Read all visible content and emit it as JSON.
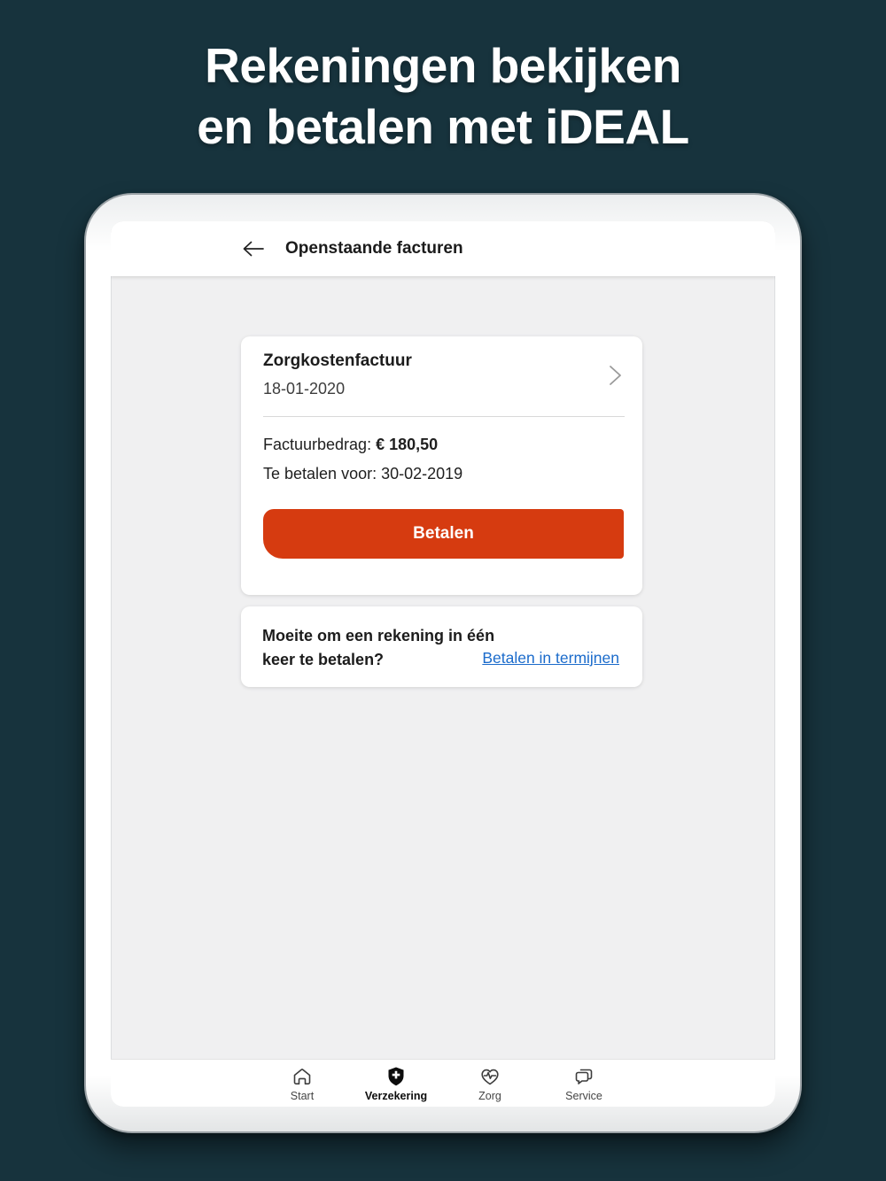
{
  "hero": {
    "title_line1": "Rekeningen bekijken",
    "title_line2": "en betalen met iDEAL"
  },
  "app": {
    "header": {
      "title": "Openstaande facturen",
      "back_icon": "arrow-left"
    },
    "invoice_card": {
      "title": "Zorgkostenfactuur",
      "date": "18-01-2020",
      "chevron_icon": "chevron-right",
      "amount_label": "Factuurbedrag: ",
      "amount_value": "€ 180,50",
      "due_label": "Te betalen voor: ",
      "due_value": "30-02-2019",
      "pay_button_label": "Betalen"
    },
    "installments_card": {
      "question_line1": "Moeite om een rekening in één",
      "question_line2": "keer te betalen?",
      "link_label": "Betalen in termijnen"
    },
    "tabbar": {
      "items": [
        {
          "label": "Start",
          "icon": "home-icon",
          "active": false
        },
        {
          "label": "Verzekering",
          "icon": "shield-plus-icon",
          "active": true
        },
        {
          "label": "Zorg",
          "icon": "heart-pulse-icon",
          "active": false
        },
        {
          "label": "Service",
          "icon": "chat-bubbles-icon",
          "active": false
        }
      ]
    }
  },
  "colors": {
    "background_teal": "#17333d",
    "accent_red": "#d63b10",
    "link_blue": "#1b6bcb",
    "screen_gray": "#f0f0f1",
    "card_white": "#ffffff"
  }
}
